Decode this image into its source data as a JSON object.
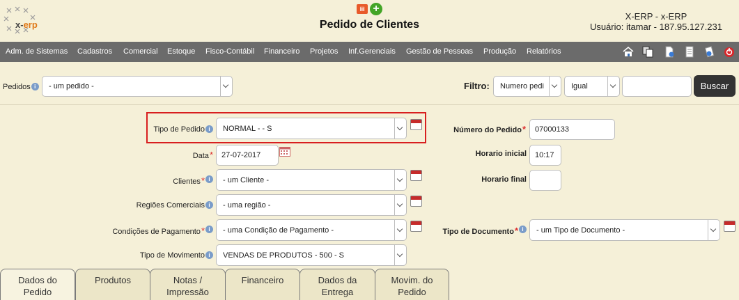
{
  "header": {
    "logo_text_a": "x-",
    "logo_text_b": "erp",
    "title": "Pedido de Clientes",
    "system": "X-ERP - x-ERP",
    "user": "Usuário: itamar - 187.95.127.231"
  },
  "menu": {
    "items": [
      "Adm. de Sistemas",
      "Cadastros",
      "Comercial",
      "Estoque",
      "Fisco-Contábil",
      "Financeiro",
      "Projetos",
      "Inf.Gerenciais",
      "Gestão de Pessoas",
      "Produção",
      "Relatórios"
    ]
  },
  "filterbar": {
    "pedidos_label": "Pedidos",
    "pedidos_value": "- um pedido -",
    "filtro_label": "Filtro:",
    "filtro_field": "Numero pedi",
    "filtro_op": "Igual",
    "filtro_text": "",
    "buscar_label": "Buscar"
  },
  "form": {
    "tipo_pedido_label": "Tipo de Pedido",
    "tipo_pedido_value": "NORMAL - - S",
    "data_label": "Data",
    "data_value": "27-07-2017",
    "clientes_label": "Clientes",
    "clientes_value": "- um Cliente -",
    "regioes_label": "Regiões Comerciais",
    "regioes_value": "- uma região -",
    "condicoes_label": "Condições de Pagamento",
    "condicoes_value": "- uma Condição de Pagamento -",
    "movimento_label": "Tipo de Movimento",
    "movimento_value": "VENDAS DE PRODUTOS - 500 - S",
    "numero_label": "Número do Pedido",
    "numero_value": "07000133",
    "hora_ini_label": "Horario inicial",
    "hora_ini_value": "10:17",
    "hora_fim_label": "Horario final",
    "hora_fim_value": "",
    "documento_label": "Tipo de Documento",
    "documento_value": "- um Tipo de Documento -"
  },
  "tabs": [
    {
      "l1": "Dados do",
      "l2": "Pedido"
    },
    {
      "l1": "Produtos",
      "l2": ""
    },
    {
      "l1": "Notas /",
      "l2": "Impressão"
    },
    {
      "l1": "Financeiro",
      "l2": ""
    },
    {
      "l1": "Dados da",
      "l2": "Entrega"
    },
    {
      "l1": "Movim. do",
      "l2": "Pedido"
    }
  ],
  "colors": {
    "background": "#f5f0d8",
    "menubar": "#6b6b6b",
    "highlight": "#d81f1f",
    "button": "#333333"
  },
  "icons": {
    "toolbar": [
      "home-icon",
      "copy-icon",
      "new-document-icon",
      "document-icon",
      "search-document-icon",
      "power-icon"
    ]
  }
}
